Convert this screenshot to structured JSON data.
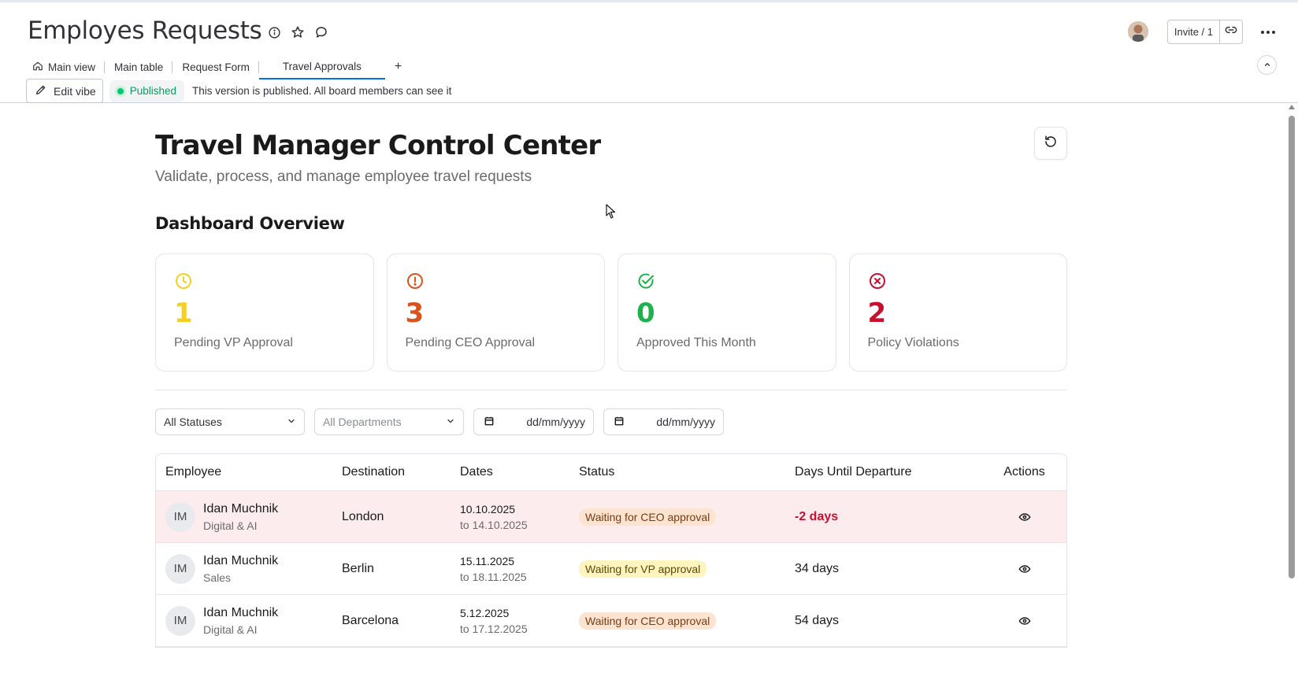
{
  "board": {
    "title": "Employes Requests",
    "invite_label": "Invite / 1"
  },
  "tabs": [
    {
      "label": "Main view",
      "icon": "home-icon"
    },
    {
      "label": "Main table"
    },
    {
      "label": "Request Form"
    },
    {
      "label": "Travel Approvals",
      "active": true
    }
  ],
  "tab_add_label": "+",
  "publish": {
    "edit_label": "Edit vibe",
    "status_label": "Published",
    "message": "This version is published. All board members can see it"
  },
  "app": {
    "title": "Travel Manager Control Center",
    "subtitle": "Validate, process, and manage employee travel requests",
    "section_title": "Dashboard Overview"
  },
  "cards": [
    {
      "value": "1",
      "label": "Pending VP Approval",
      "icon": "clock-icon",
      "color": "#f5d020"
    },
    {
      "value": "3",
      "label": "Pending CEO Approval",
      "icon": "alert-circle-icon",
      "color": "#d9531e"
    },
    {
      "value": "0",
      "label": "Approved This Month",
      "icon": "check-circle-icon",
      "color": "#1eb24d"
    },
    {
      "value": "2",
      "label": "Policy Violations",
      "icon": "x-circle-icon",
      "color": "#c8102e"
    }
  ],
  "filters": {
    "status": "All Statuses",
    "department": "All Departments",
    "date_from": "dd/mm/yyyy",
    "date_to": "dd/mm/yyyy"
  },
  "table": {
    "columns": [
      "Employee",
      "Destination",
      "Dates",
      "Status",
      "Days Until Departure",
      "Actions"
    ],
    "rows": [
      {
        "initials": "IM",
        "name": "Idan Muchnik",
        "dept": "Digital & AI",
        "destination": "London",
        "from": "10.10.2025",
        "to": "to 14.10.2025",
        "status": "Waiting for CEO approval",
        "status_type": "ceo",
        "days": "-2 days",
        "overdue": true
      },
      {
        "initials": "IM",
        "name": "Idan Muchnik",
        "dept": "Sales",
        "destination": "Berlin",
        "from": "15.11.2025",
        "to": "to 18.11.2025",
        "status": "Waiting for VP approval",
        "status_type": "vp",
        "days": "34 days",
        "overdue": false
      },
      {
        "initials": "IM",
        "name": "Idan Muchnik",
        "dept": "Digital & AI",
        "destination": "Barcelona",
        "from": "5.12.2025",
        "to": "to 17.12.2025",
        "status": "Waiting for CEO approval",
        "status_type": "ceo",
        "days": "54 days",
        "overdue": false
      }
    ]
  }
}
